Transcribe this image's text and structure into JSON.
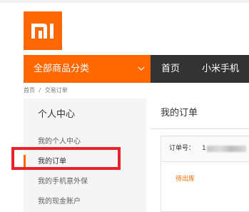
{
  "colors": {
    "brand": "#ff6700",
    "nav_dark": "#333333",
    "highlight_box": "#e8232c"
  },
  "logo": {
    "text": "mi",
    "icon": "mi-logo-icon"
  },
  "nav": {
    "category_label": "全部商品分类",
    "category_icon": "chevron-down-icon",
    "items": [
      "首页",
      "小米手机"
    ]
  },
  "breadcrumb": [
    "首页",
    "/",
    "交易订单"
  ],
  "sidebar": {
    "title": "个人中心",
    "items": [
      "我的个人中心",
      "我的订单",
      "我的手机意外保",
      "我的现金账户"
    ],
    "active_index": 1
  },
  "main": {
    "title": "我的订单",
    "order": {
      "number_label": "订单号：",
      "number_value": "1",
      "status": "待出库"
    }
  }
}
